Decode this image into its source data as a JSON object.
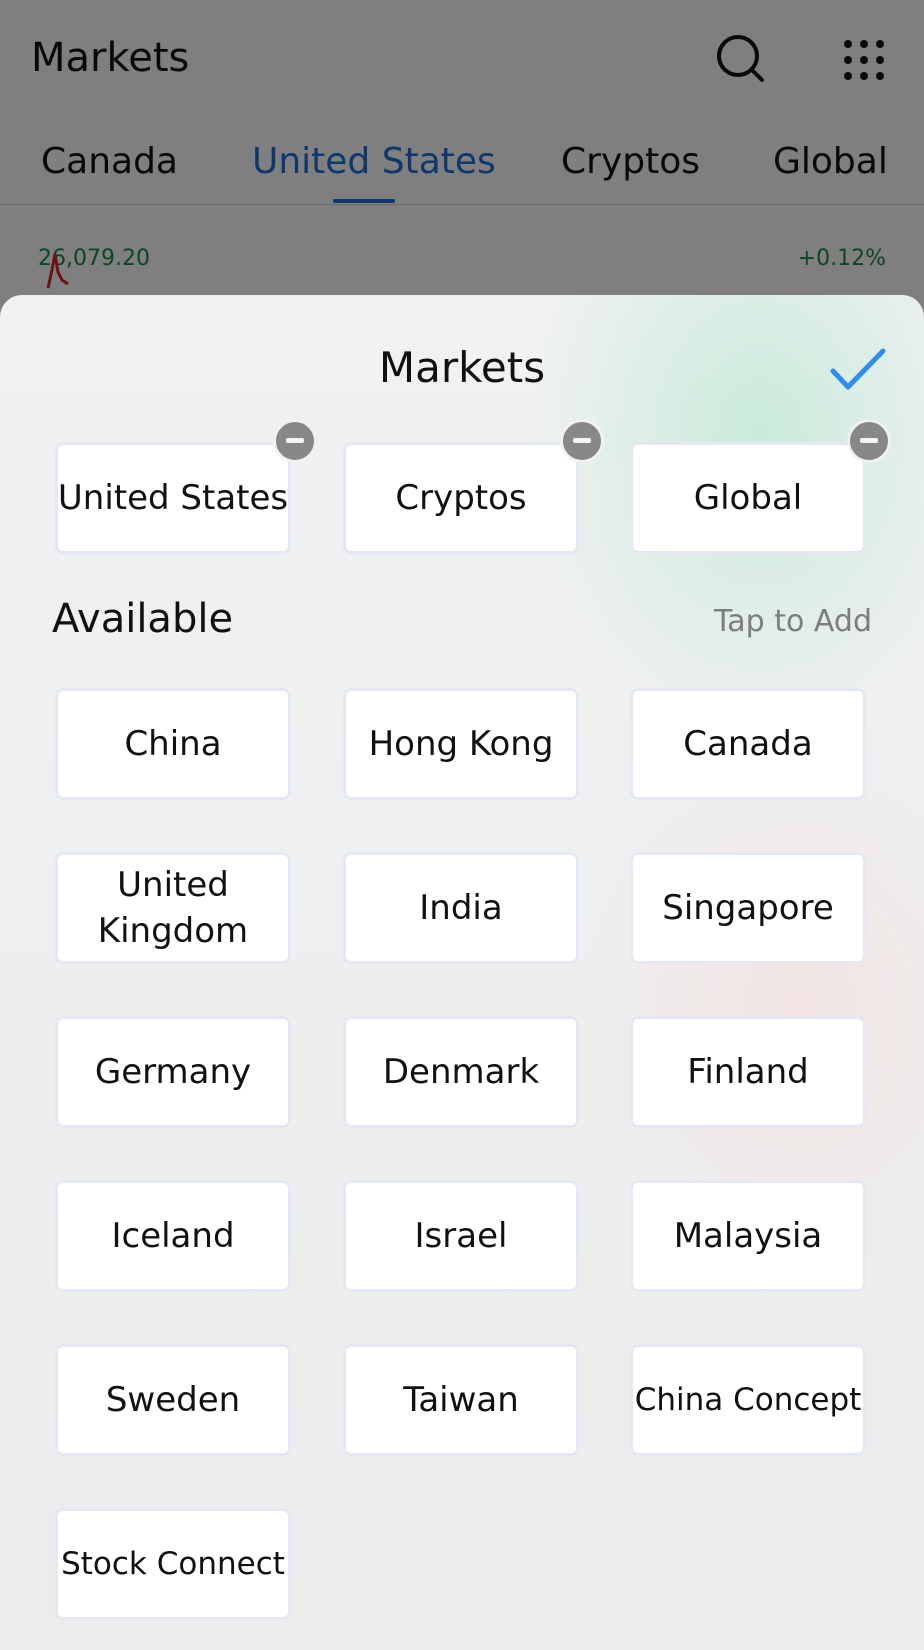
{
  "header": {
    "title": "Markets"
  },
  "tabs": [
    {
      "label": "Canada"
    },
    {
      "label": "United States"
    },
    {
      "label": "Cryptos"
    },
    {
      "label": "Global"
    }
  ],
  "quote": {
    "value": "26,079.20",
    "change": "+0.12%"
  },
  "sheet": {
    "title": "Markets",
    "selected": [
      {
        "label": "United States"
      },
      {
        "label": "Cryptos"
      },
      {
        "label": "Global"
      }
    ],
    "available_label": "Available",
    "tap_hint": "Tap to Add",
    "available": [
      {
        "label": "China"
      },
      {
        "label": "Hong Kong"
      },
      {
        "label": "Canada"
      },
      {
        "label": "United Kingdom"
      },
      {
        "label": "India"
      },
      {
        "label": "Singapore"
      },
      {
        "label": "Germany"
      },
      {
        "label": "Denmark"
      },
      {
        "label": "Finland"
      },
      {
        "label": "Iceland"
      },
      {
        "label": "Israel"
      },
      {
        "label": "Malaysia"
      },
      {
        "label": "Sweden"
      },
      {
        "label": "Taiwan"
      },
      {
        "label": "China Concept"
      },
      {
        "label": "Stock Connect"
      }
    ]
  },
  "colors": {
    "accent": "#1e6fd9",
    "positive": "#1a8a4a",
    "confirm": "#2f8cf0"
  },
  "icons": {
    "search": "search-icon",
    "menu": "grid-menu-icon",
    "confirm": "checkmark-icon",
    "remove": "minus-circle-icon"
  }
}
